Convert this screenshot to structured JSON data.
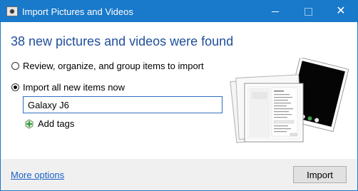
{
  "window": {
    "title": "Import Pictures and Videos",
    "accent_color": "#1979ca",
    "icons": {
      "app": "camera-icon",
      "minimize": "minimize-icon",
      "maximize": "maximize-icon",
      "close": "close-icon"
    }
  },
  "main": {
    "heading": "38 new pictures and videos were found",
    "options": [
      {
        "label": "Review, organize, and group items to import",
        "selected": false
      },
      {
        "label": "Import all new items now",
        "selected": true
      }
    ],
    "tag_input_value": "Galaxy J6",
    "add_tags_label": "Add tags",
    "add_tags_icon": "tag-add-icon",
    "preview_icon": "photo-stack-icon"
  },
  "footer": {
    "more_options_label": "More options",
    "import_button_label": "Import"
  }
}
